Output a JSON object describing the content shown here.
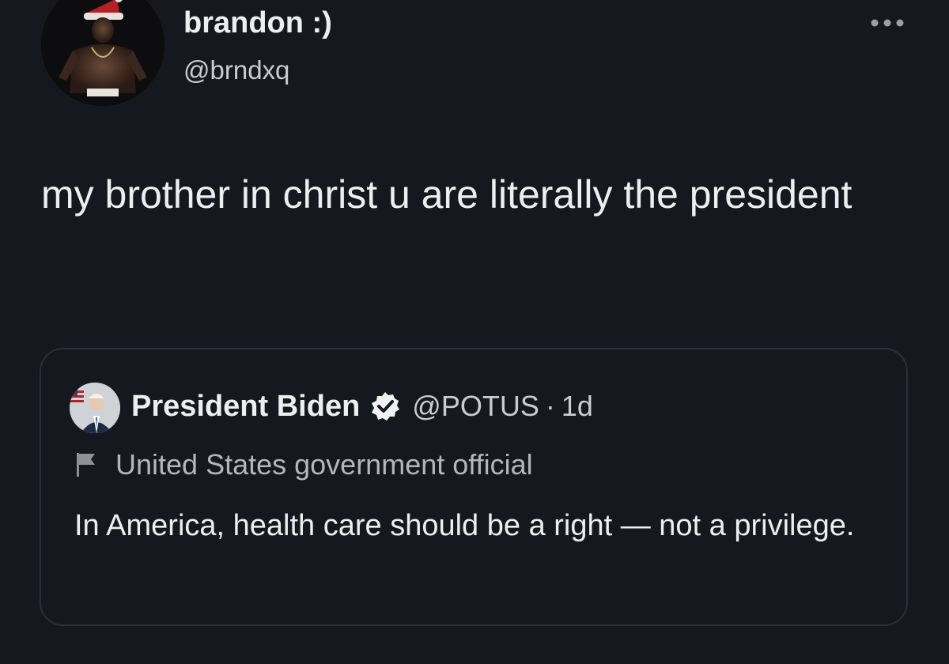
{
  "tweet": {
    "author": {
      "display_name": "brandon :)",
      "handle": "@brndxq",
      "avatar_icon": "profile-photo"
    },
    "more_icon": "more-horizontal-icon",
    "text": "my brother in christ u are literally the president",
    "quoted_tweet": {
      "author": {
        "display_name": "President Biden",
        "handle": "@POTUS",
        "verified_icon": "verified-badge-icon",
        "avatar_icon": "profile-photo"
      },
      "separator": "·",
      "time": "1d",
      "label_icon": "flag-icon",
      "label": "United States government official",
      "text": "In America, health care should be a right — not a privilege."
    }
  },
  "colors": {
    "background": "#15181f",
    "text": "#eceef0",
    "muted": "#c9ccd0",
    "border": "#2b3038"
  }
}
